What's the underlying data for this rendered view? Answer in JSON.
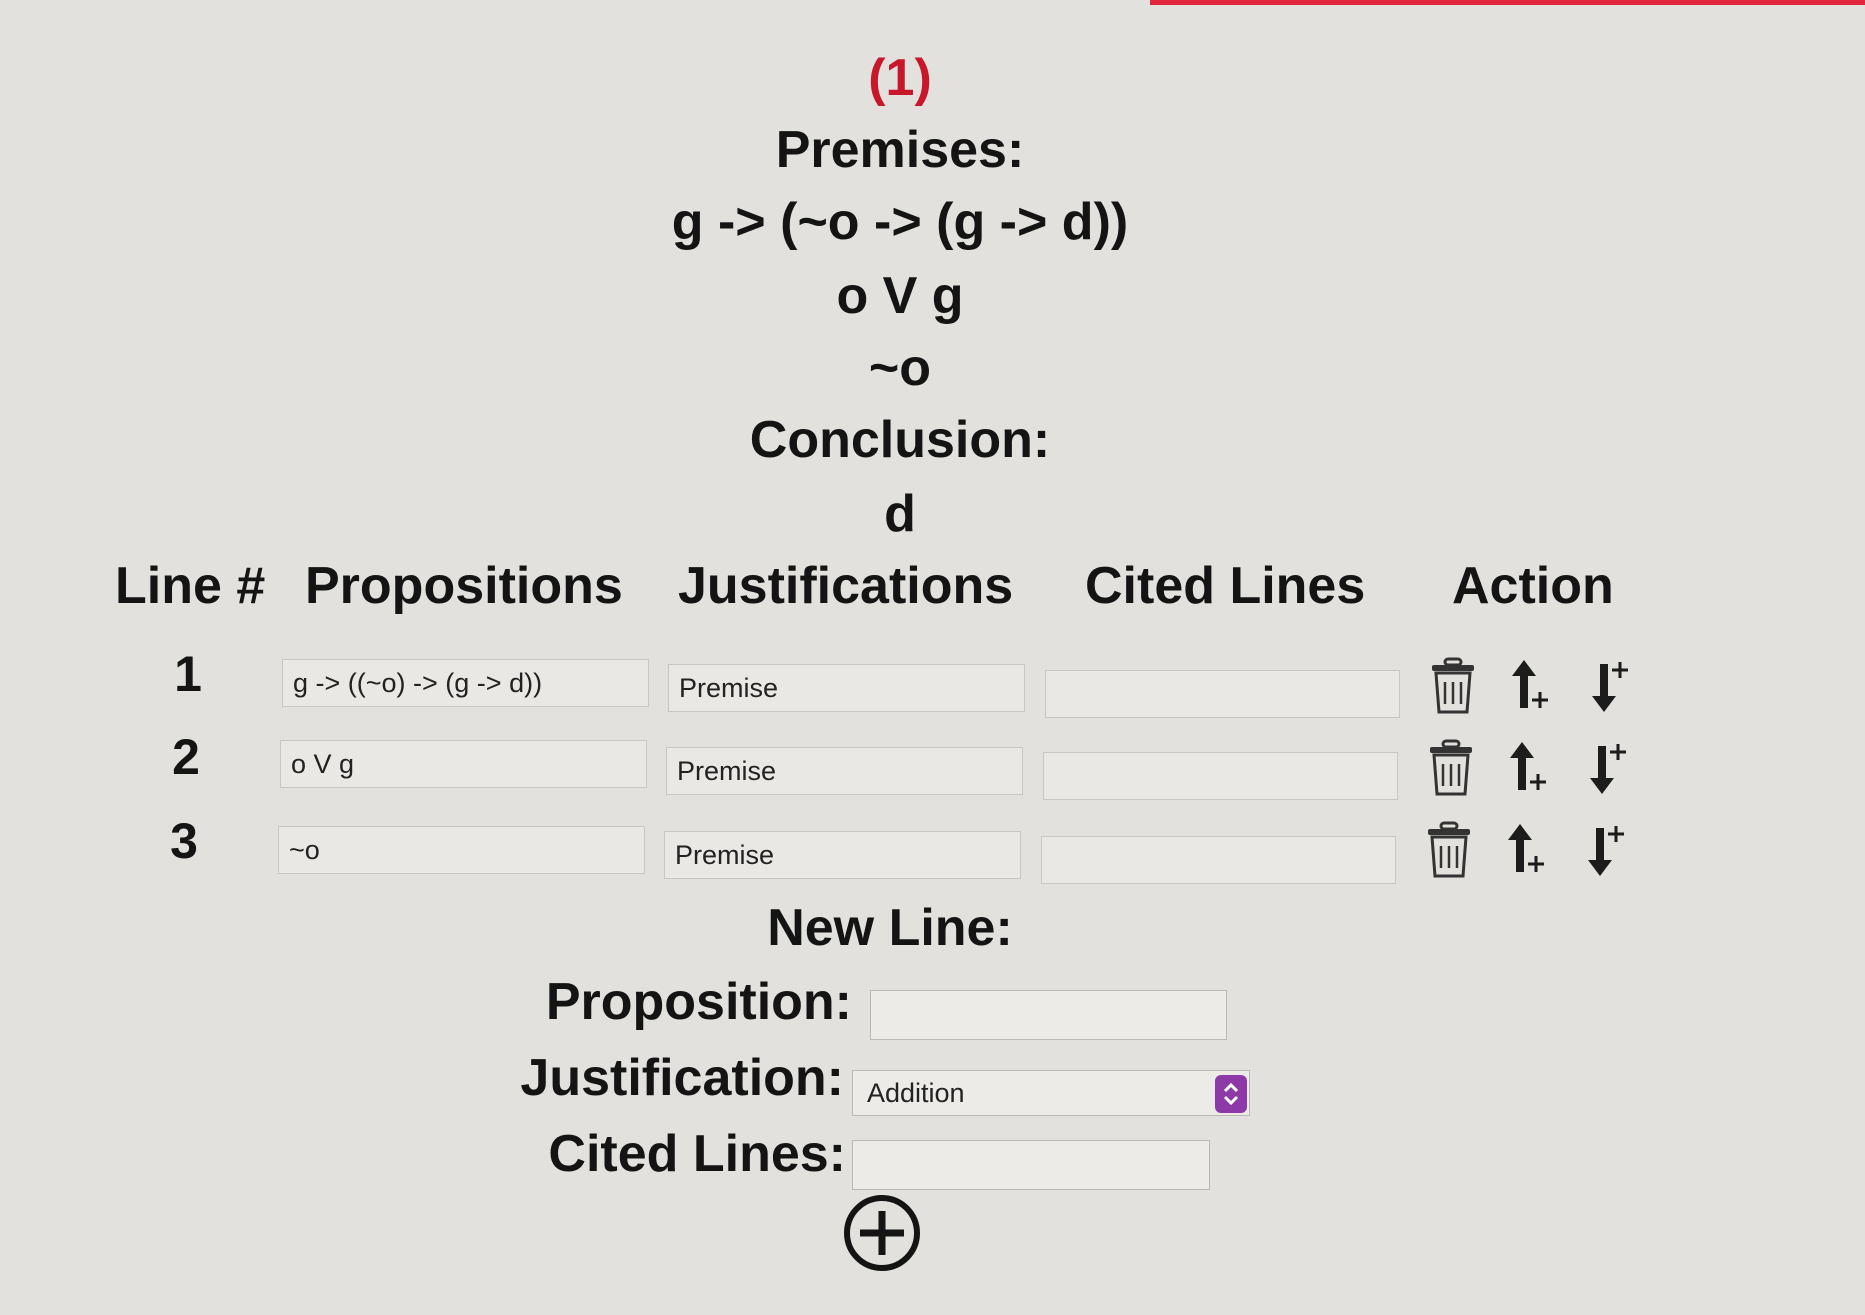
{
  "problem": {
    "number": "(1)",
    "premises_label": "Premises:",
    "premises": [
      "g -> (~o -> (g -> d))",
      "o V g",
      "~o"
    ],
    "conclusion_label": "Conclusion:",
    "conclusion": "d"
  },
  "table": {
    "headers": {
      "line": "Line #",
      "propositions": "Propositions",
      "justifications": "Justifications",
      "cited": "Cited Lines",
      "action": "Action"
    },
    "rows": [
      {
        "line": "1",
        "proposition": "g -> ((~o) -> (g -> d))",
        "justification": "Premise",
        "cited": ""
      },
      {
        "line": "2",
        "proposition": "o V g",
        "justification": "Premise",
        "cited": ""
      },
      {
        "line": "3",
        "proposition": "~o",
        "justification": "Premise",
        "cited": ""
      }
    ],
    "action_icons": [
      "trash-icon",
      "arrow-up-plus-icon",
      "arrow-down-plus-icon"
    ]
  },
  "new_line": {
    "title": "New Line:",
    "proposition_label": "Proposition:",
    "proposition_value": "",
    "justification_label": "Justification:",
    "justification_selected": "Addition",
    "cited_label": "Cited Lines:",
    "cited_value": "",
    "add_icon": "plus-circle-icon"
  },
  "colors": {
    "accent": "#e0263a",
    "problem_number": "#c8162b",
    "select_arrow": "#8d3aa8",
    "background": "#e2e1dd"
  }
}
